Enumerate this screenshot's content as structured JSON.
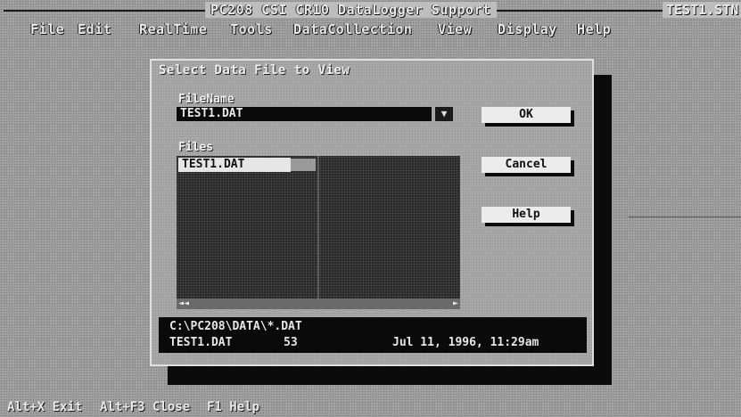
{
  "window": {
    "app_title": "PC208 CSI CR10 DataLogger Support",
    "file_title": "TEST1.STN"
  },
  "menu": {
    "items": [
      "File",
      "Edit",
      "RealTime",
      "Tools",
      "DataCollection",
      "View",
      "Display",
      "Help"
    ]
  },
  "dialog": {
    "title": "Select Data File to View",
    "filename_label": "FileName",
    "filename_value": "TEST1.DAT",
    "filename_arrow": "▼",
    "files_label": "Files",
    "files": [
      "TEST1.DAT"
    ],
    "scroll_left": "◄◄",
    "scroll_right": "►",
    "path_line": "C:\\PC208\\DATA\\*.DAT",
    "detail_name": "TEST1.DAT",
    "detail_size": "53",
    "detail_date": "Jul 11, 1996, 11:29am",
    "buttons": {
      "ok": "OK",
      "cancel": "Cancel",
      "help": "Help"
    }
  },
  "status_bar": {
    "items": [
      "Alt+X Exit",
      "Alt+F3 Close",
      "F1 Help"
    ]
  }
}
